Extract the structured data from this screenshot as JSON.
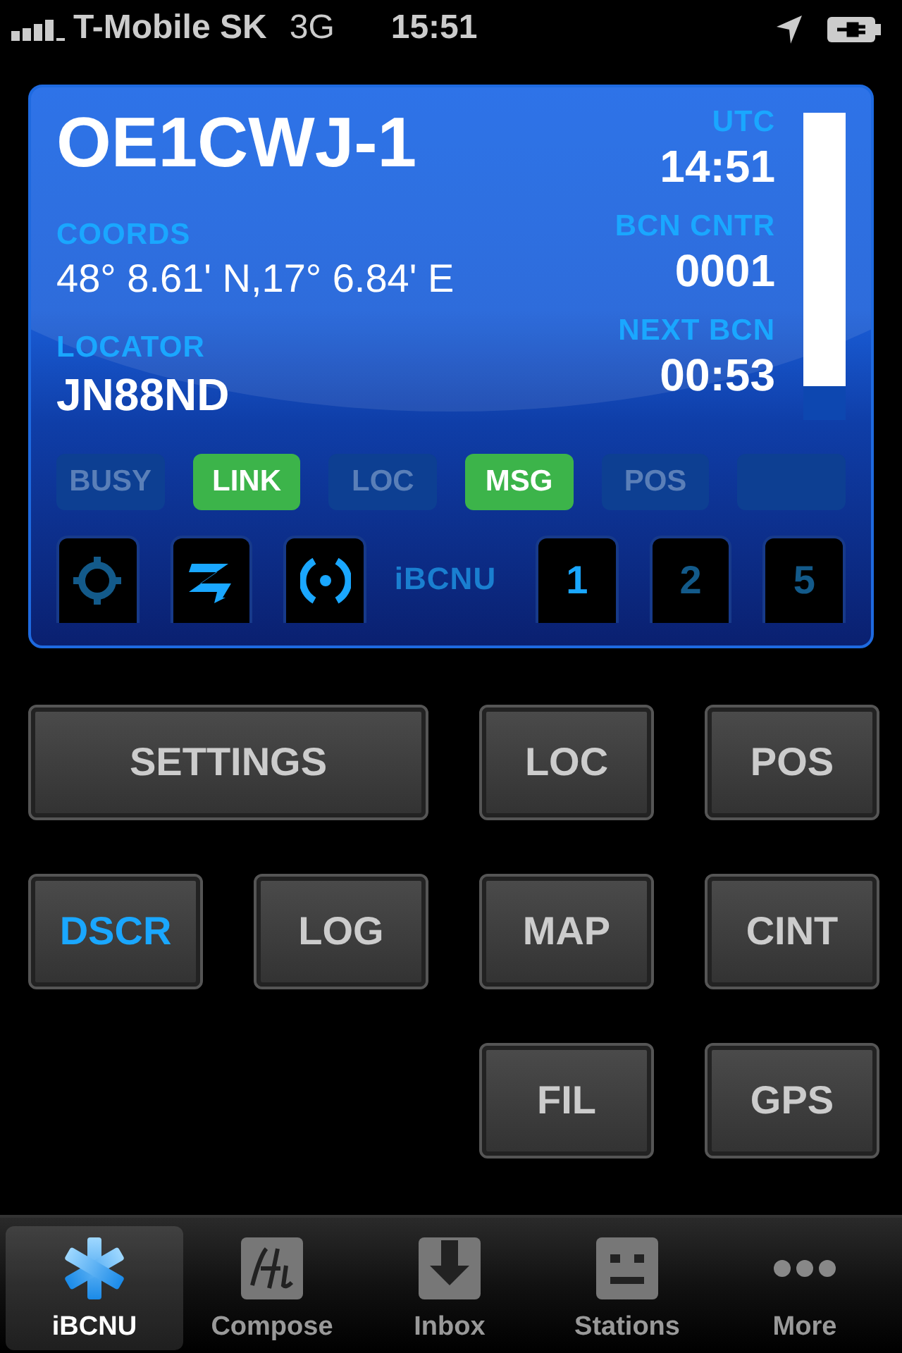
{
  "status_bar": {
    "carrier": "T-Mobile SK",
    "network": "3G",
    "time": "15:51"
  },
  "panel": {
    "callsign": "OE1CWJ-1",
    "left": [
      {
        "label": "COORDS",
        "value": "48° 8.61' N,17° 6.84' E"
      },
      {
        "label": "LOCATOR",
        "value": "JN88ND"
      }
    ],
    "right": [
      {
        "label": "UTC",
        "value": "14:51"
      },
      {
        "label": "BCN CNTR",
        "value": "0001"
      },
      {
        "label": "NEXT BCN",
        "value": "00:53"
      }
    ],
    "meter": {
      "level": 0.89
    },
    "indicators": [
      {
        "label": "BUSY",
        "on": false
      },
      {
        "label": "LINK",
        "on": true
      },
      {
        "label": "LOC",
        "on": false
      },
      {
        "label": "MSG",
        "on": true
      },
      {
        "label": "POS",
        "on": false
      },
      {
        "on": false
      }
    ],
    "mode_tabs": [
      {
        "kind": "crosshair",
        "active": false
      },
      {
        "kind": "zigzag",
        "active": true
      },
      {
        "kind": "broadcast",
        "active": true
      }
    ],
    "brand": "iBCNU",
    "slot_tabs": [
      {
        "label": "1",
        "selected": true
      },
      {
        "label": "2",
        "selected": false
      },
      {
        "label": "5",
        "selected": false
      }
    ]
  },
  "button_rows": [
    [
      {
        "label": "SETTINGS",
        "highlighted": false
      },
      {
        "label": "LOC",
        "highlighted": false
      },
      {
        "label": "POS",
        "highlighted": false
      }
    ],
    [
      {
        "label": "DSCR",
        "highlighted": true
      },
      {
        "label": "LOG",
        "highlighted": false
      },
      {
        "label": "MAP",
        "highlighted": false
      },
      {
        "label": "CINT",
        "highlighted": false
      }
    ],
    [
      {
        "label": "FIL",
        "highlighted": false
      },
      {
        "label": "GPS",
        "highlighted": false
      }
    ]
  ],
  "tab_bar": [
    {
      "kind": "asterisk",
      "label": "iBCNU",
      "selected": true
    },
    {
      "kind": "compose",
      "label": "Compose",
      "selected": false
    },
    {
      "kind": "inbox",
      "label": "Inbox",
      "selected": false
    },
    {
      "kind": "stations",
      "label": "Stations",
      "selected": false
    },
    {
      "kind": "more",
      "label": "More",
      "selected": false
    }
  ]
}
